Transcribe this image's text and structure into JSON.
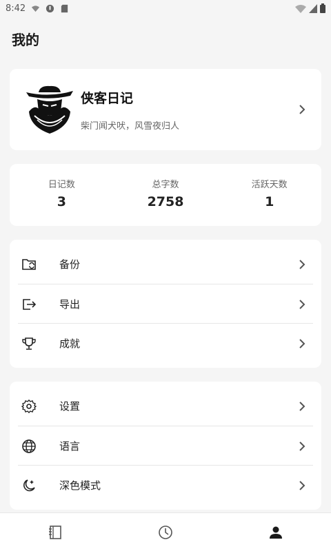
{
  "status_bar": {
    "time": "8:42",
    "left_icons": [
      "wifi-calling-icon",
      "app-notification-icon",
      "sd-card-icon"
    ],
    "right_icons": [
      "wifi-icon",
      "signal-icon",
      "battery-icon"
    ]
  },
  "page": {
    "title": "我的"
  },
  "profile": {
    "name": "侠客日记",
    "motto": "柴门闻犬吠，风雪夜归人",
    "avatar_icon": "swordsman-hat-avatar-icon"
  },
  "stats": [
    {
      "label": "日记数",
      "value": "3"
    },
    {
      "label": "总字数",
      "value": "2758"
    },
    {
      "label": "活跃天数",
      "value": "1"
    }
  ],
  "menu_group_1": [
    {
      "label": "备份",
      "icon": "folder-sync-icon"
    },
    {
      "label": "导出",
      "icon": "export-icon"
    },
    {
      "label": "成就",
      "icon": "trophy-icon"
    }
  ],
  "menu_group_2": [
    {
      "label": "设置",
      "icon": "gear-icon"
    },
    {
      "label": "语言",
      "icon": "globe-icon"
    },
    {
      "label": "深色模式",
      "icon": "moon-star-icon"
    }
  ],
  "bottom_nav": {
    "items": [
      {
        "icon": "diary-book-icon",
        "active": false
      },
      {
        "icon": "clock-icon",
        "active": false
      },
      {
        "icon": "person-icon",
        "active": true
      }
    ],
    "active_color": "#1a1a1a",
    "inactive_color": "#555555"
  }
}
